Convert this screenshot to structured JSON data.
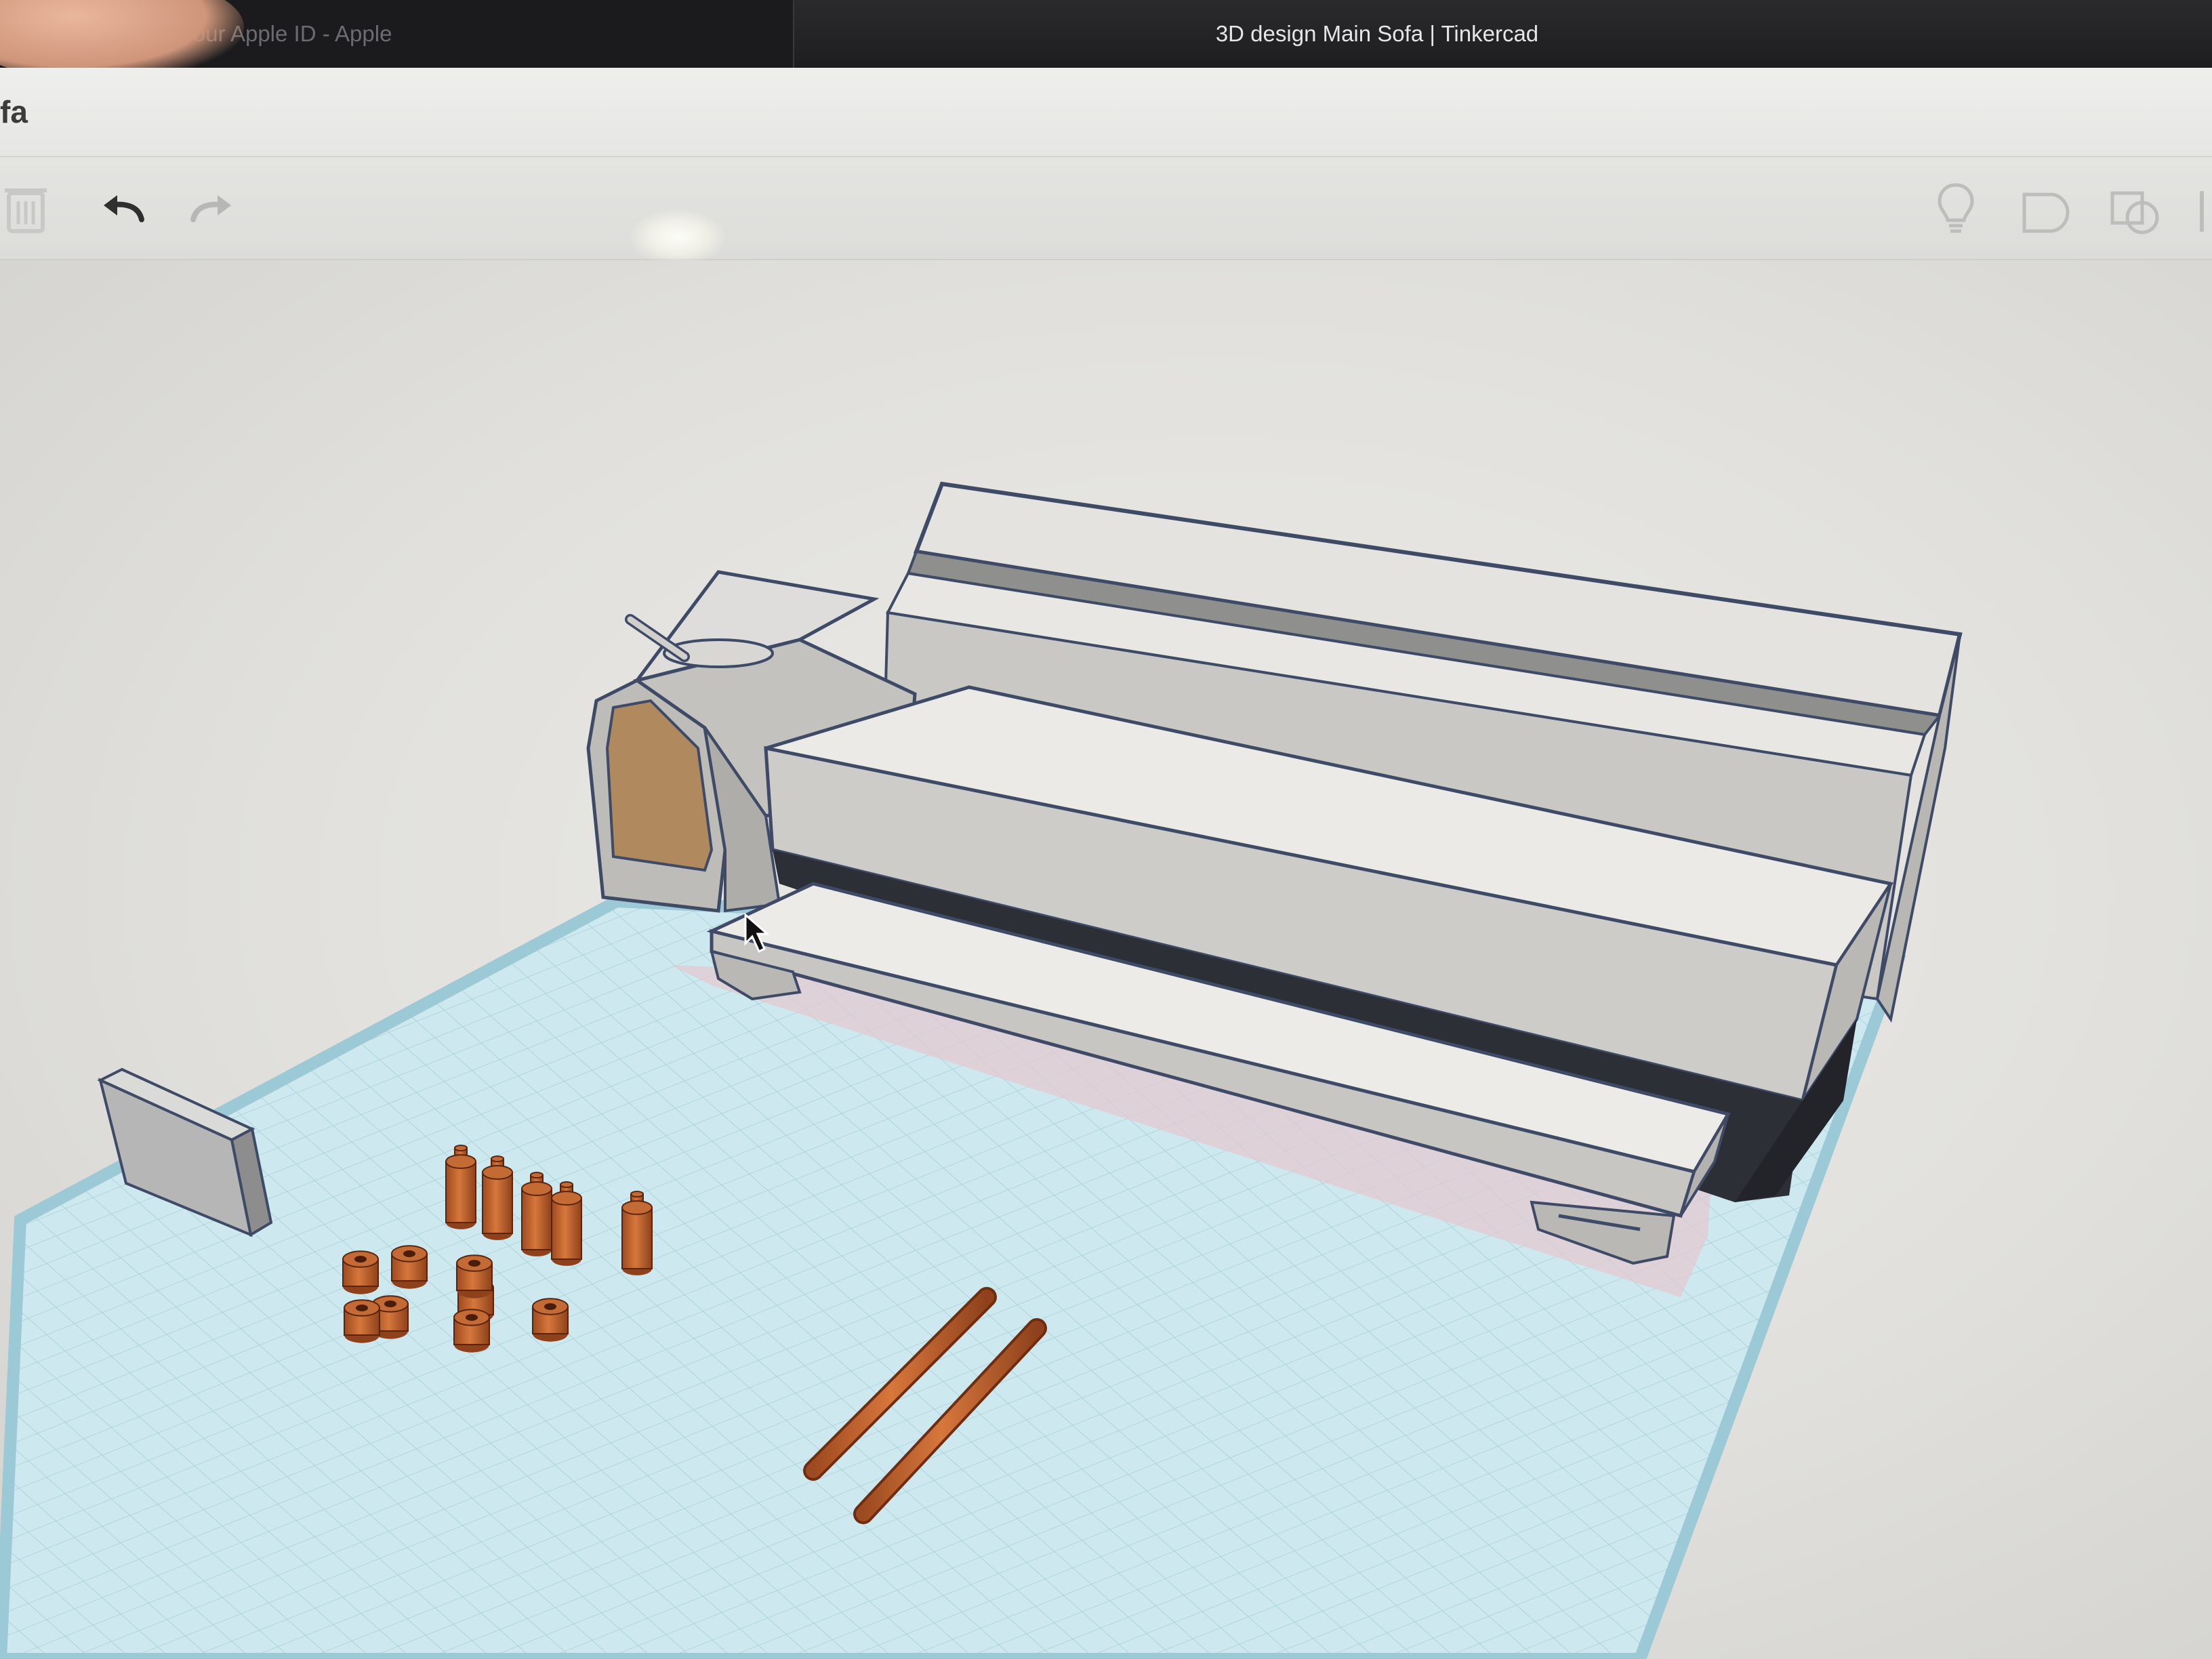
{
  "browser": {
    "tabs": [
      {
        "label": "Manage your Apple ID - Apple",
        "active": false
      },
      {
        "label": "3D design Main Sofa | Tinkercad",
        "active": true
      }
    ]
  },
  "app": {
    "design_title": "fa"
  },
  "toolbar": {
    "left": [
      {
        "icon": "trash-icon",
        "label": "Delete"
      },
      {
        "icon": "undo-icon",
        "label": "Undo"
      },
      {
        "icon": "redo-icon",
        "label": "Redo"
      }
    ],
    "right": [
      {
        "icon": "lightbulb-icon",
        "label": "Show all"
      },
      {
        "icon": "group-icon",
        "label": "Group"
      },
      {
        "icon": "ungroup-icon",
        "label": "Ungroup"
      }
    ]
  },
  "colors": {
    "workplane_grid": "#b9dfe8",
    "shape_gray": "#c9c8c5",
    "shape_wood": "#c76a34",
    "shape_tan": "#b08a5e",
    "selection_edge": "#3e4a66"
  }
}
